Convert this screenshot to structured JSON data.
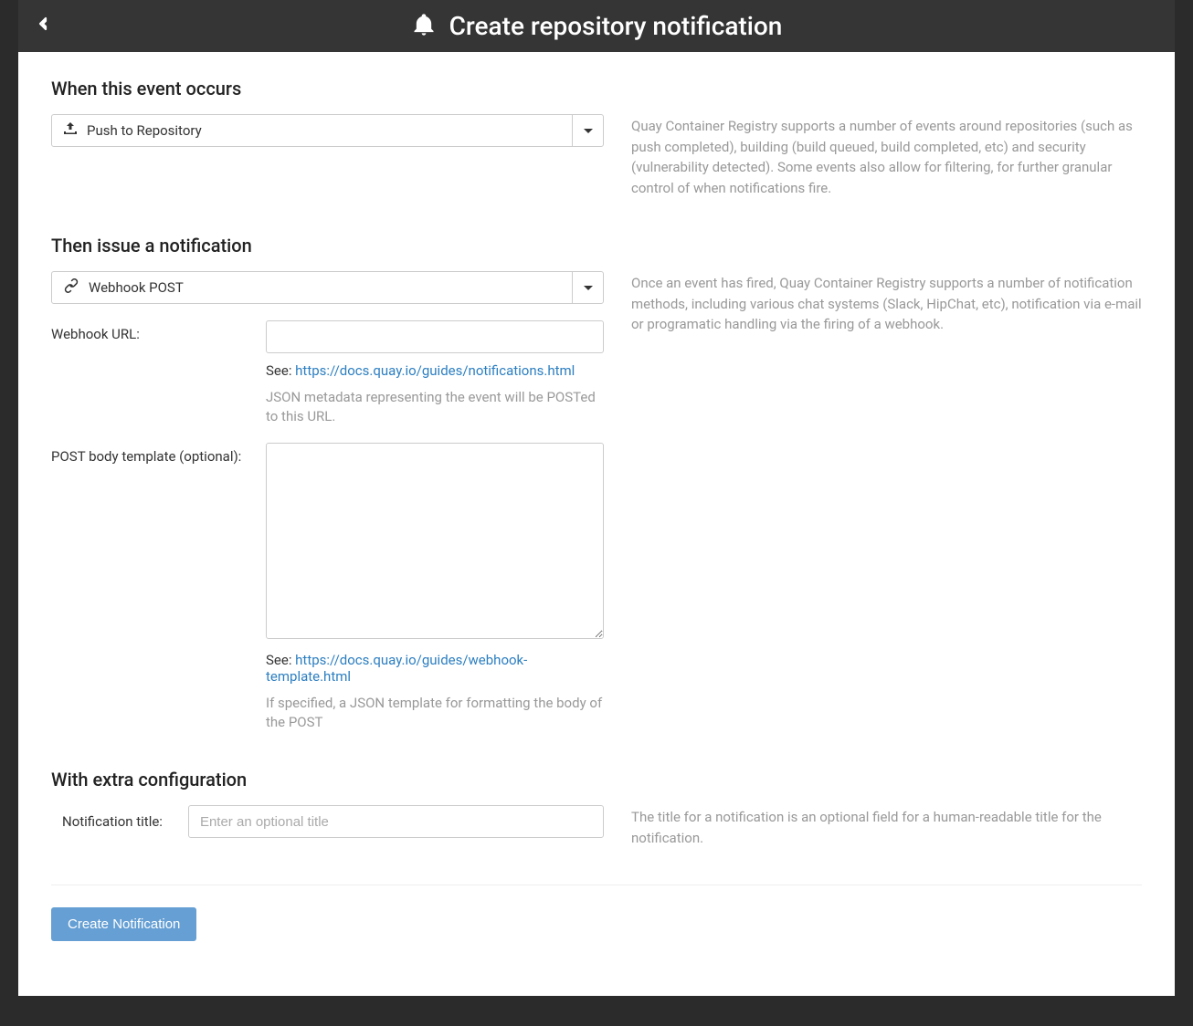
{
  "header": {
    "title": "Create repository notification"
  },
  "event": {
    "heading": "When this event occurs",
    "selected": "Push to Repository",
    "help": "Quay Container Registry supports a number of events around repositories (such as push completed), building (build queued, build completed, etc) and security (vulnerability detected). Some events also allow for filtering, for further granular control of when notifications fire."
  },
  "method": {
    "heading": "Then issue a notification",
    "selected": "Webhook POST",
    "help": "Once an event has fired, Quay Container Registry supports a number of notification methods, including various chat systems (Slack, HipChat, etc), notification via e-mail or programatic handling via the firing of a webhook.",
    "webhook_url": {
      "label": "Webhook URL:",
      "value": "",
      "see_prefix": "See: ",
      "see_link": "https://docs.quay.io/guides/notifications.html",
      "desc": "JSON metadata representing the event will be POSTed to this URL."
    },
    "post_body": {
      "label": "POST body template (optional):",
      "value": "",
      "see_prefix": "See: ",
      "see_link": "https://docs.quay.io/guides/webhook-template.html",
      "desc": "If specified, a JSON template for formatting the body of the POST"
    }
  },
  "config": {
    "heading": "With extra configuration",
    "title_label": "Notification title:",
    "title_placeholder": "Enter an optional title",
    "title_value": "",
    "help": "The title for a notification is an optional field for a human-readable title for the notification."
  },
  "footer": {
    "create_label": "Create Notification"
  }
}
